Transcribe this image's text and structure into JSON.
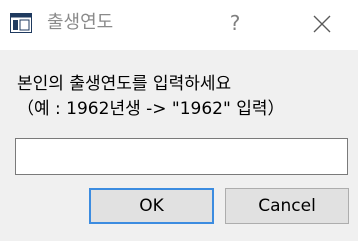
{
  "window": {
    "title": "출생연도",
    "help_label": "?",
    "icons": {
      "app": "window-app-icon",
      "close": "close-icon"
    }
  },
  "prompt": {
    "line1": "본인의 출생연도를 입력하세요",
    "line2": "（예 : 1962년생 -> \"1962\" 입력）"
  },
  "input": {
    "value": "",
    "placeholder": ""
  },
  "buttons": {
    "ok_label": "OK",
    "cancel_label": "Cancel"
  },
  "colors": {
    "default_button_border": "#3c8ce0",
    "dialog_background": "#f0f0f0"
  }
}
